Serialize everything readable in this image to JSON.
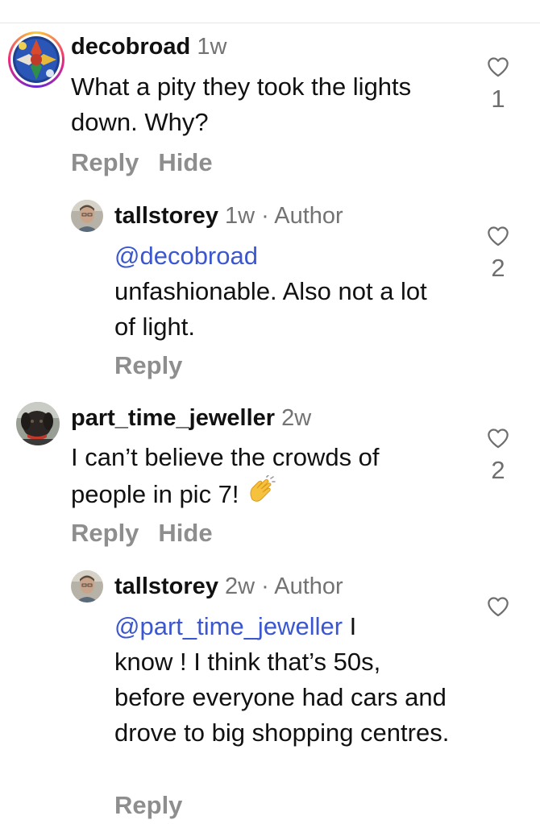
{
  "comments": [
    {
      "username": "decobroad",
      "time": "1w",
      "text": "What a pity they took the lights down. Why?",
      "actions": {
        "reply": "Reply",
        "hide": "Hide"
      },
      "likes": "1",
      "avatar_icon": "stained-glass-avatar",
      "story_ring": true
    },
    {
      "username": "tallstorey",
      "time": "1w",
      "author_tag": "· Author",
      "mention": "@decobroad",
      "text": "unfashionable. Also not a lot of light.",
      "actions": {
        "reply": "Reply"
      },
      "likes": "2",
      "avatar_icon": "man-portrait-avatar"
    },
    {
      "username": "part_time_jeweller",
      "time": "2w",
      "text": "I can’t believe the crowds of people in pic 7!",
      "emoji": "👏",
      "actions": {
        "reply": "Reply",
        "hide": "Hide"
      },
      "likes": "2",
      "avatar_icon": "dog-avatar"
    },
    {
      "username": "tallstorey",
      "time": "2w",
      "author_tag": "· Author",
      "mention": "@part_time_jeweller",
      "text_after_mention": " I",
      "text": "know ! I think that’s 50s, before everyone had cars and drove to big shopping centres.",
      "actions": {
        "reply": "Reply"
      },
      "likes": "",
      "avatar_icon": "man-portrait-avatar"
    }
  ],
  "colors": {
    "mention": "#3b57d0",
    "secondary_text": "#737373",
    "action_text": "#8e8e8e",
    "heart_stroke": "#6e6e6e"
  }
}
